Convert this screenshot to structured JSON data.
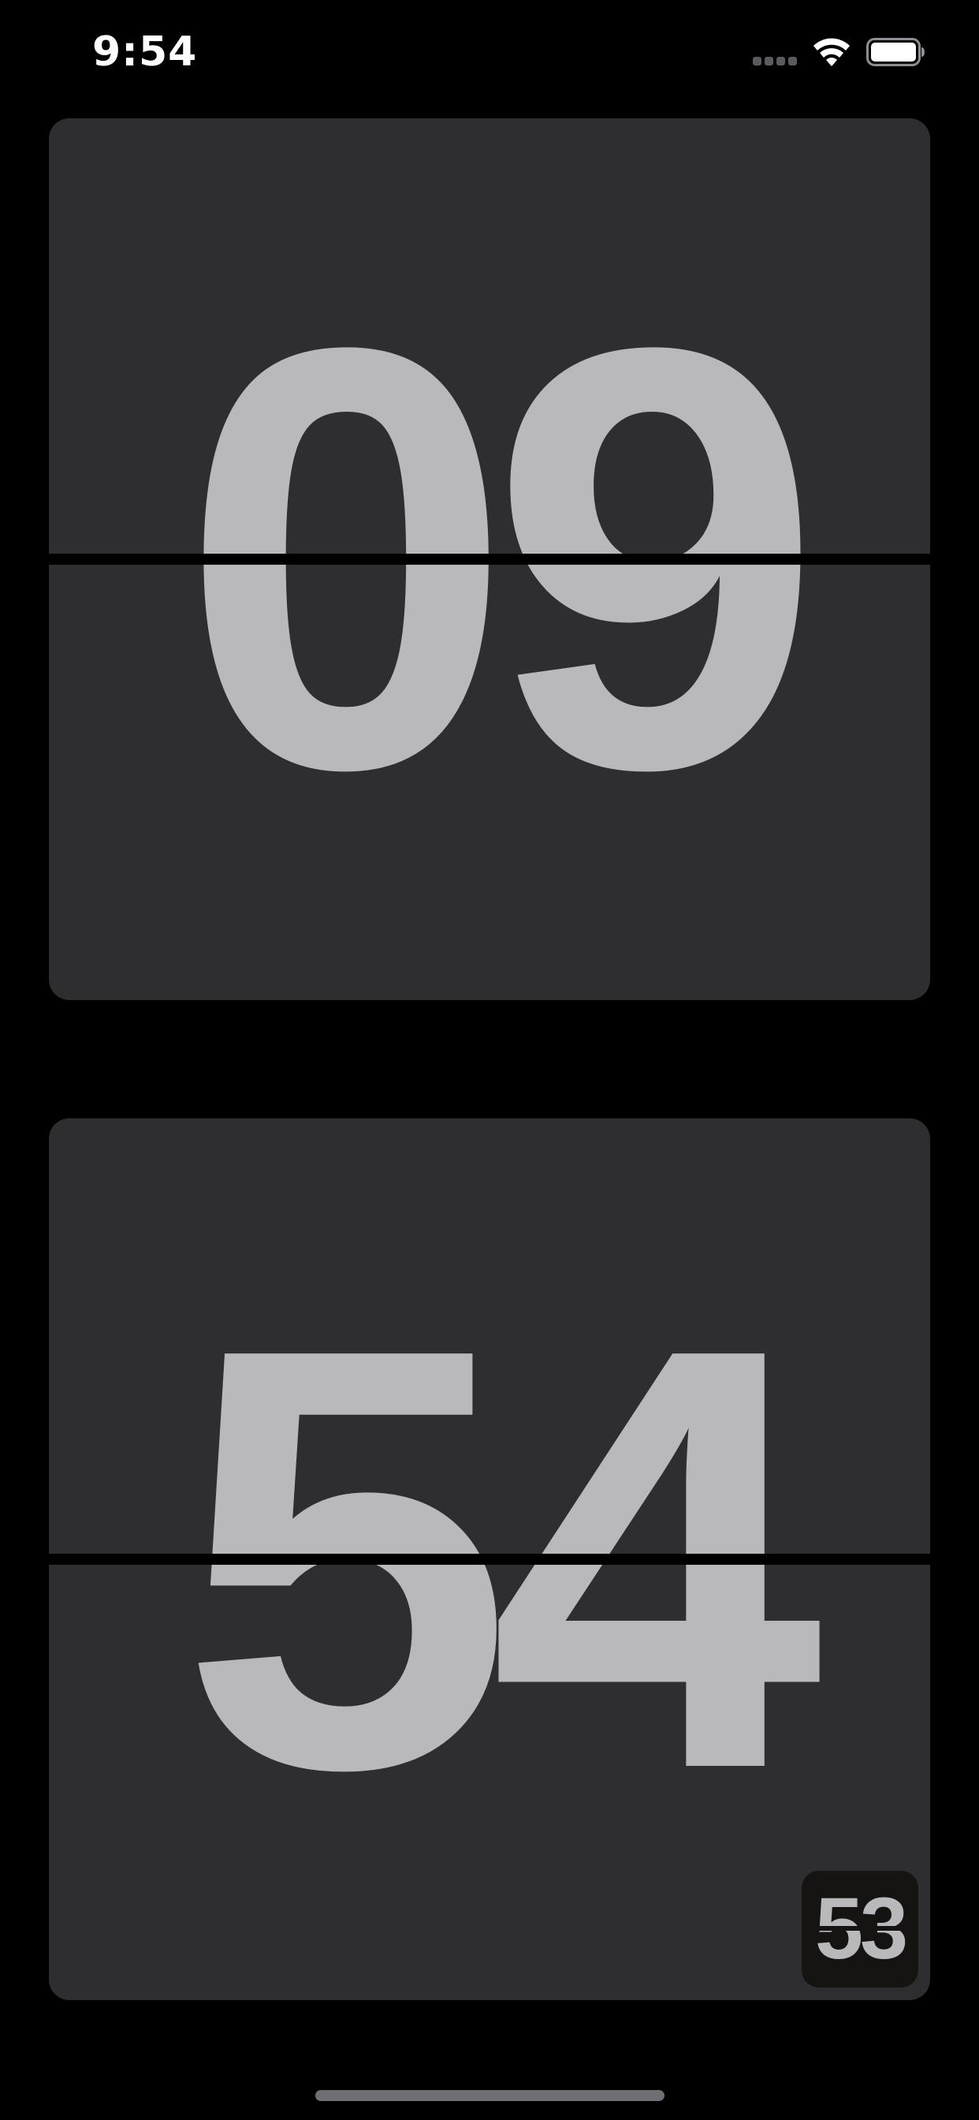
{
  "status_bar": {
    "time": "9:54",
    "icons": [
      "signal-icon",
      "wifi-icon",
      "battery-icon"
    ]
  },
  "clock": {
    "hours": "09",
    "minutes": "54",
    "seconds": "53"
  },
  "colors": {
    "background": "#000000",
    "card": "#2e2d30",
    "digits": "#b9b8bb",
    "seconds_card": "#151412"
  }
}
